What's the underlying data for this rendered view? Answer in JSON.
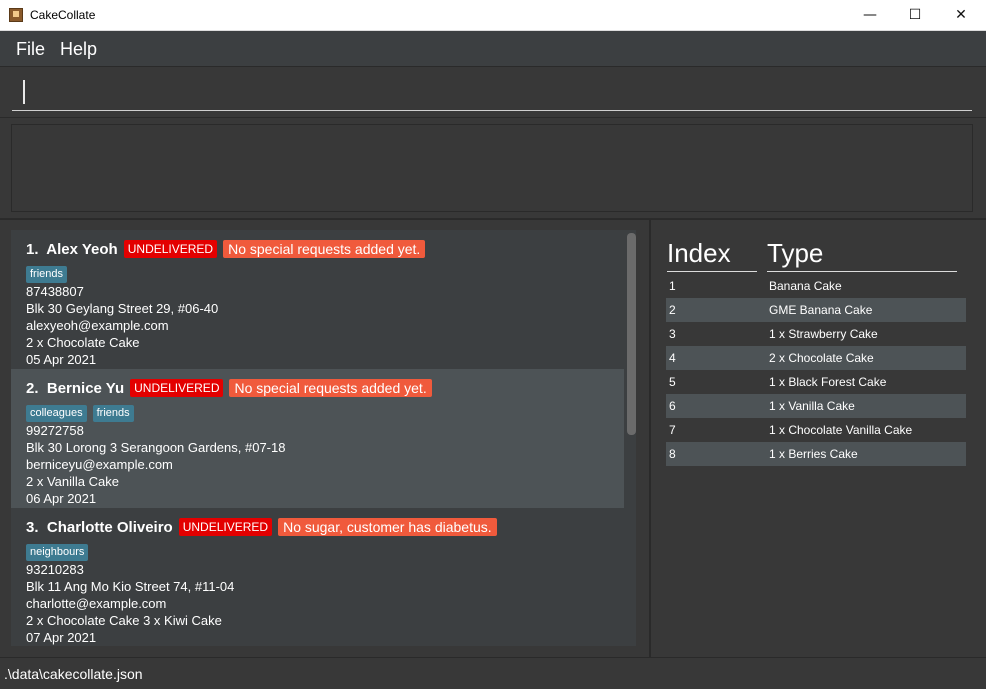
{
  "window": {
    "title": "CakeCollate",
    "controls": {
      "minimize": "—",
      "maximize": "☐",
      "close": "✕"
    }
  },
  "menu": {
    "items": [
      "File",
      "Help"
    ]
  },
  "command": {
    "value": "",
    "placeholder": ""
  },
  "result": {
    "text": ""
  },
  "orders": [
    {
      "index": "1.",
      "name": "Alex Yeoh",
      "status": "UNDELIVERED",
      "request": "No special requests added yet.",
      "tags": [
        "friends"
      ],
      "phone": "87438807",
      "address": "Blk 30 Geylang Street 29, #06-40",
      "email": "alexyeoh@example.com",
      "items": "2 x Chocolate Cake",
      "date": "05 Apr 2021"
    },
    {
      "index": "2.",
      "name": "Bernice Yu",
      "status": "UNDELIVERED",
      "request": "No special requests added yet.",
      "tags": [
        "colleagues",
        "friends"
      ],
      "phone": "99272758",
      "address": "Blk 30 Lorong 3 Serangoon Gardens, #07-18",
      "email": "berniceyu@example.com",
      "items": "2 x Vanilla Cake",
      "date": "06 Apr 2021"
    },
    {
      "index": "3.",
      "name": "Charlotte Oliveiro",
      "status": "UNDELIVERED",
      "request": "No sugar, customer has diabetus.",
      "tags": [
        "neighbours"
      ],
      "phone": "93210283",
      "address": "Blk 11 Ang Mo Kio Street 74, #11-04",
      "email": "charlotte@example.com",
      "items": "2 x Chocolate Cake 3 x Kiwi Cake",
      "date": "07 Apr 2021"
    }
  ],
  "item_table": {
    "headers": {
      "index": "Index",
      "type": "Type"
    },
    "rows": [
      {
        "index": "1",
        "type": "Banana Cake"
      },
      {
        "index": "2",
        "type": "GME Banana Cake"
      },
      {
        "index": "3",
        "type": "1 x Strawberry Cake"
      },
      {
        "index": "4",
        "type": "2 x Chocolate Cake"
      },
      {
        "index": "5",
        "type": "1 x Black Forest Cake"
      },
      {
        "index": "6",
        "type": "1 x Vanilla Cake"
      },
      {
        "index": "7",
        "type": "1 x Chocolate Vanilla Cake"
      },
      {
        "index": "8",
        "type": "1 x Berries Cake"
      }
    ]
  },
  "status_bar": {
    "path": ".\\data\\cakecollate.json"
  },
  "colors": {
    "status_badge": "#e30000",
    "request_badge": "#f05a3c",
    "tag": "#3e7b91"
  }
}
